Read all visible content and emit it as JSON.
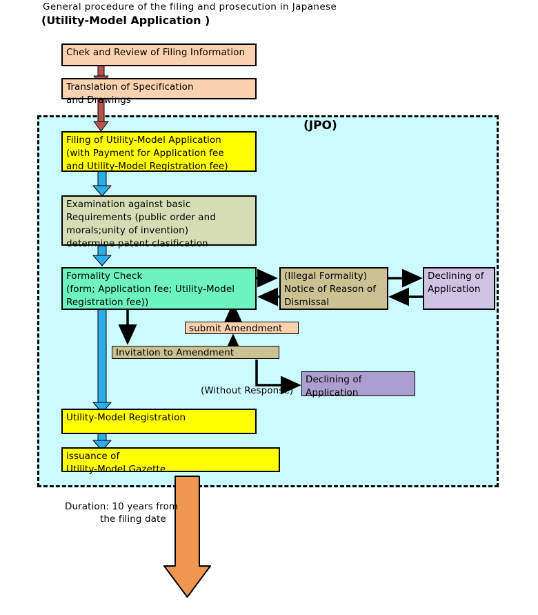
{
  "header": {
    "line1": "General procedure of the filing and prosecution in Japanese",
    "line2": "(Utility-Model Application )"
  },
  "container": {
    "label": "(JPO)",
    "fill": "#ccfbff",
    "border_style": "dashed",
    "border_color": "#000000"
  },
  "colors": {
    "peach": "#fbd2b0",
    "yellow": "#ffff00",
    "olive": "#d6dcb4",
    "mint": "#6df3c0",
    "tan": "#cbc193",
    "lilac": "#cfc2e2",
    "purple": "#ad9ecf",
    "arrow_red": "#b85450",
    "arrow_blue": "#2badea",
    "arrow_orange": "#ef9650",
    "arrow_black": "#000000"
  },
  "nodes": {
    "check_review": "Chek and Review of Filing Information",
    "translation": "Translation of Specification\nand Drawings",
    "filing": "Filing of Utility-Model Application\n(with Payment for Application fee\nand Utility-Model Registration fee)",
    "examination": "Examination against basic\nRequirements (public order and\nmorals;unity of invention)\ndetermine patent clasification",
    "formality_check": "Formality Check\n(form; Application fee; Utility-Model\nRegistration fee))",
    "illegal_formality": "(Illegal Formality)\nNotice of Reason of\nDismissal",
    "declining_top": "Declining of\nApplication",
    "submit_amendment": "submit Amendment",
    "invitation_amendment": "Invitation to Amendment",
    "declining_bottom": "Declining of\nApplication",
    "registration": "Utility-Model Registration",
    "gazette": "issuance of\nUtility-Model Gazette"
  },
  "labels": {
    "without_response": "(Without Response)",
    "duration_line1": "Duration: 10 years from",
    "duration_line2": "the filing date"
  }
}
